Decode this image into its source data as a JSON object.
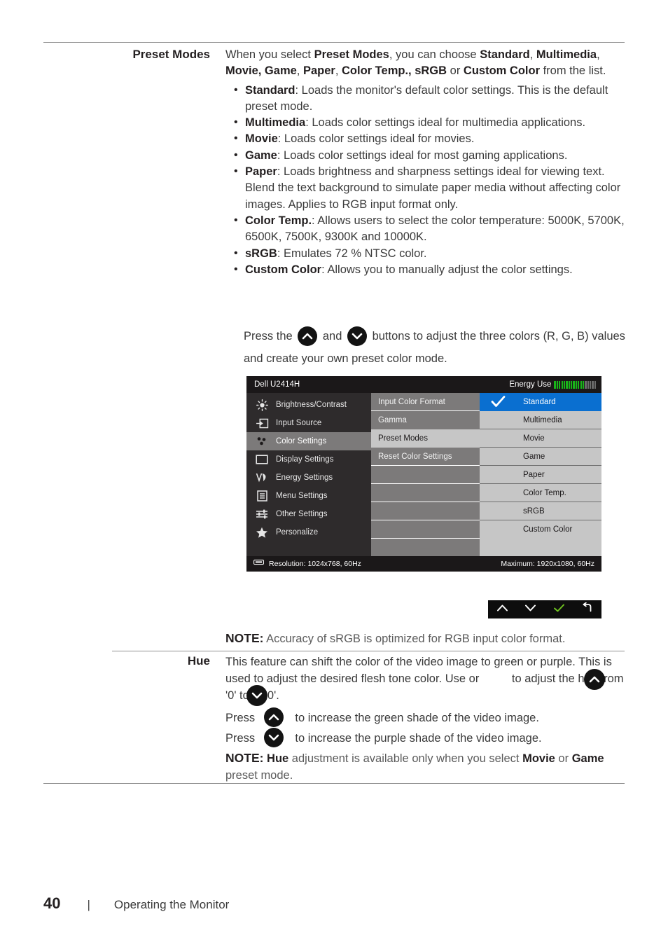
{
  "page": {
    "number": "40",
    "separator": "|",
    "section": "Operating the Monitor"
  },
  "rows": [
    {
      "label": "Preset Modes"
    },
    {
      "label": "Hue"
    }
  ],
  "preset_modes": {
    "label": "Preset Modes",
    "intro_pre": "When you select ",
    "intro_b1": "Preset Modes",
    "intro_mid1": ", you can choose ",
    "intro_b2": "Standard",
    "intro_mid2": ", ",
    "intro_b3": "Multimedia",
    "intro_mid3": ", ",
    "intro_b4": "Movie, Game",
    "intro_mid4": ", ",
    "intro_b5": "Paper",
    "intro_mid5": ", ",
    "intro_b6": "Color Temp.,",
    "intro_mid6": "  ",
    "intro_b7": "sRGB",
    "intro_mid7": " or ",
    "intro_b8": "Custom Color",
    "intro_tail": " from the list.",
    "bullets": [
      {
        "term": "Standard",
        "desc": ": Loads the monitor's default color settings. This is the default preset mode."
      },
      {
        "term": "Multimedia",
        "desc": ": Loads color settings ideal for multimedia applications."
      },
      {
        "term": "Movie",
        "desc": ": Loads color settings ideal for movies."
      },
      {
        "term": "Game",
        "desc": ": Loads color settings ideal for most gaming applications."
      },
      {
        "term": "Paper",
        "desc": ": Loads brightness and sharpness settings ideal for viewing text. Blend the text background to simulate paper media without affecting color images. Applies to RGB input format only."
      },
      {
        "term": "Color Temp.",
        "desc": ": Allows users to select the color temperature: 5000K, 5700K, 6500K, 7500K, 9300K and 10000K."
      },
      {
        "term": "sRGB",
        "desc": ": Emulates 72 % NTSC color."
      },
      {
        "term": "Custom Color",
        "desc": ": Allows you to manually adjust the color settings."
      }
    ],
    "press_pre": "Press the ",
    "press_mid": " and ",
    "press_post": " buttons to adjust the three colors (R, G, B) values and create your own preset color mode.",
    "note_label": "NOTE:",
    "note_text": " Accuracy of sRGB is optimized for RGB input color format."
  },
  "osd": {
    "title": "Dell U2414H",
    "energy_label": "Energy Use",
    "energy_bars_green": 13,
    "energy_bars_gray": 5,
    "energy_green_color": "#19b319",
    "energy_gray_color": "#6b6b6b",
    "menu_items": [
      {
        "label": "Brightness/Contrast",
        "icon": "brightness-icon",
        "active": false
      },
      {
        "label": "Input Source",
        "icon": "input-source-icon",
        "active": false
      },
      {
        "label": "Color Settings",
        "icon": "color-settings-icon",
        "active": true
      },
      {
        "label": "Display Settings",
        "icon": "display-settings-icon",
        "active": false
      },
      {
        "label": "Energy Settings",
        "icon": "energy-settings-icon",
        "active": false
      },
      {
        "label": "Menu Settings",
        "icon": "menu-settings-icon",
        "active": false
      },
      {
        "label": "Other Settings",
        "icon": "other-settings-icon",
        "active": false
      },
      {
        "label": "Personalize",
        "icon": "personalize-star-icon",
        "active": false
      }
    ],
    "sub_items": [
      {
        "label": "Input Color Format",
        "selected": false
      },
      {
        "label": "Gamma",
        "selected": false
      },
      {
        "label": "Preset Modes",
        "selected": true
      },
      {
        "label": "Reset Color Settings",
        "selected": false
      },
      {
        "label": "",
        "selected": false
      },
      {
        "label": "",
        "selected": false
      },
      {
        "label": "",
        "selected": false
      },
      {
        "label": "",
        "selected": false
      },
      {
        "label": "",
        "selected": false
      }
    ],
    "options": [
      {
        "label": "Standard",
        "selected": true
      },
      {
        "label": "Multimedia",
        "selected": false
      },
      {
        "label": "Movie",
        "selected": false
      },
      {
        "label": "Game",
        "selected": false
      },
      {
        "label": "Paper",
        "selected": false
      },
      {
        "label": "Color Temp.",
        "selected": false
      },
      {
        "label": "sRGB",
        "selected": false
      },
      {
        "label": "Custom Color",
        "selected": false
      }
    ],
    "selected_highlight_color": "#0a6fd0",
    "resolution": "Resolution: 1024x768, 60Hz",
    "maximum": "Maximum: 1920x1080, 60Hz",
    "nav_buttons": [
      {
        "icon": "chevron-up-icon",
        "color": "#ffffff"
      },
      {
        "icon": "chevron-down-icon",
        "color": "#ffffff"
      },
      {
        "icon": "check-icon",
        "color": "#6ec020"
      },
      {
        "icon": "back-arrow-icon",
        "color": "#ffffff"
      }
    ]
  },
  "hue": {
    "label": "Hue",
    "para1_a": "This feature can shift the color of the video image to green or purple. This is used to adjust the desired flesh tone color. Use",
    "para1_b": "or",
    "para1_c": "to adjust the hue from '0' to '100'.",
    "press_up_pre": "Press",
    "press_up_post": "to increase the green shade of the video image.",
    "press_down_pre": "Press",
    "press_down_post": "to increase the purple shade of the video image.",
    "note_label": "NOTE:",
    "note_b1": " Hue",
    "note_mid1": " adjustment is available only when you select ",
    "note_b2": "Movie",
    "note_mid2": " or ",
    "note_b3": "Game",
    "note_tail": " preset mode."
  }
}
